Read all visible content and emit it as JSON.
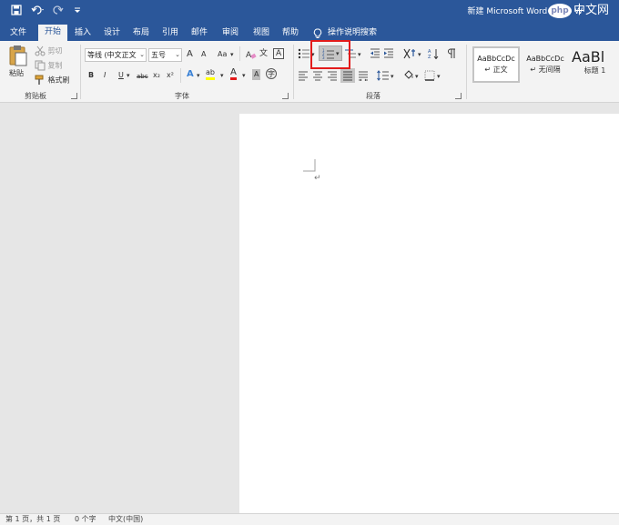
{
  "window": {
    "title": "新建 Microsoft Word 文档 - W",
    "watermark": {
      "badge": "php",
      "text": "中文网"
    }
  },
  "qat": {
    "save": "save-icon",
    "undo": "undo-icon",
    "redo": "redo-icon",
    "customize": "customize-qat-icon"
  },
  "tabs": [
    {
      "label": "文件"
    },
    {
      "label": "开始"
    },
    {
      "label": "插入"
    },
    {
      "label": "设计"
    },
    {
      "label": "布局"
    },
    {
      "label": "引用"
    },
    {
      "label": "邮件"
    },
    {
      "label": "审阅"
    },
    {
      "label": "视图"
    },
    {
      "label": "帮助"
    }
  ],
  "tell_me": "操作说明搜索",
  "clipboard": {
    "paste": "粘贴",
    "cut": "剪切",
    "copy": "复制",
    "format_painter": "格式刷",
    "group_label": "剪贴板"
  },
  "font": {
    "font_name": "等线 (中文正文",
    "font_size": "五号",
    "grow": "A",
    "shrink": "A",
    "change_case": "Aa",
    "phonetic": "文",
    "border_char": "A",
    "bold": "B",
    "italic": "I",
    "underline": "U",
    "strike": "abc",
    "subscript": "x₂",
    "superscript": "x²",
    "text_effects": "A",
    "highlight": "ab",
    "font_color": "A",
    "char_shading": "A",
    "enclose": "字",
    "group_label": "字体",
    "font_color_hex": "#e31b1b",
    "highlight_hex": "#ffff00"
  },
  "paragraph": {
    "group_label": "段落"
  },
  "styles": [
    {
      "preview": "AaBbCcDc",
      "name": "↵ 正文"
    },
    {
      "preview": "AaBbCcDc",
      "name": "↵ 无间隔"
    },
    {
      "preview": "AaBl",
      "name": "标题 1"
    }
  ],
  "status": {
    "page": "第 1 页，共 1 页",
    "words": "0 个字",
    "language": "中文(中国)"
  },
  "document": {
    "paragraph_mark": "↵"
  },
  "colors": {
    "brand": "#2b579a",
    "highlight_box": "#e31b1b"
  }
}
